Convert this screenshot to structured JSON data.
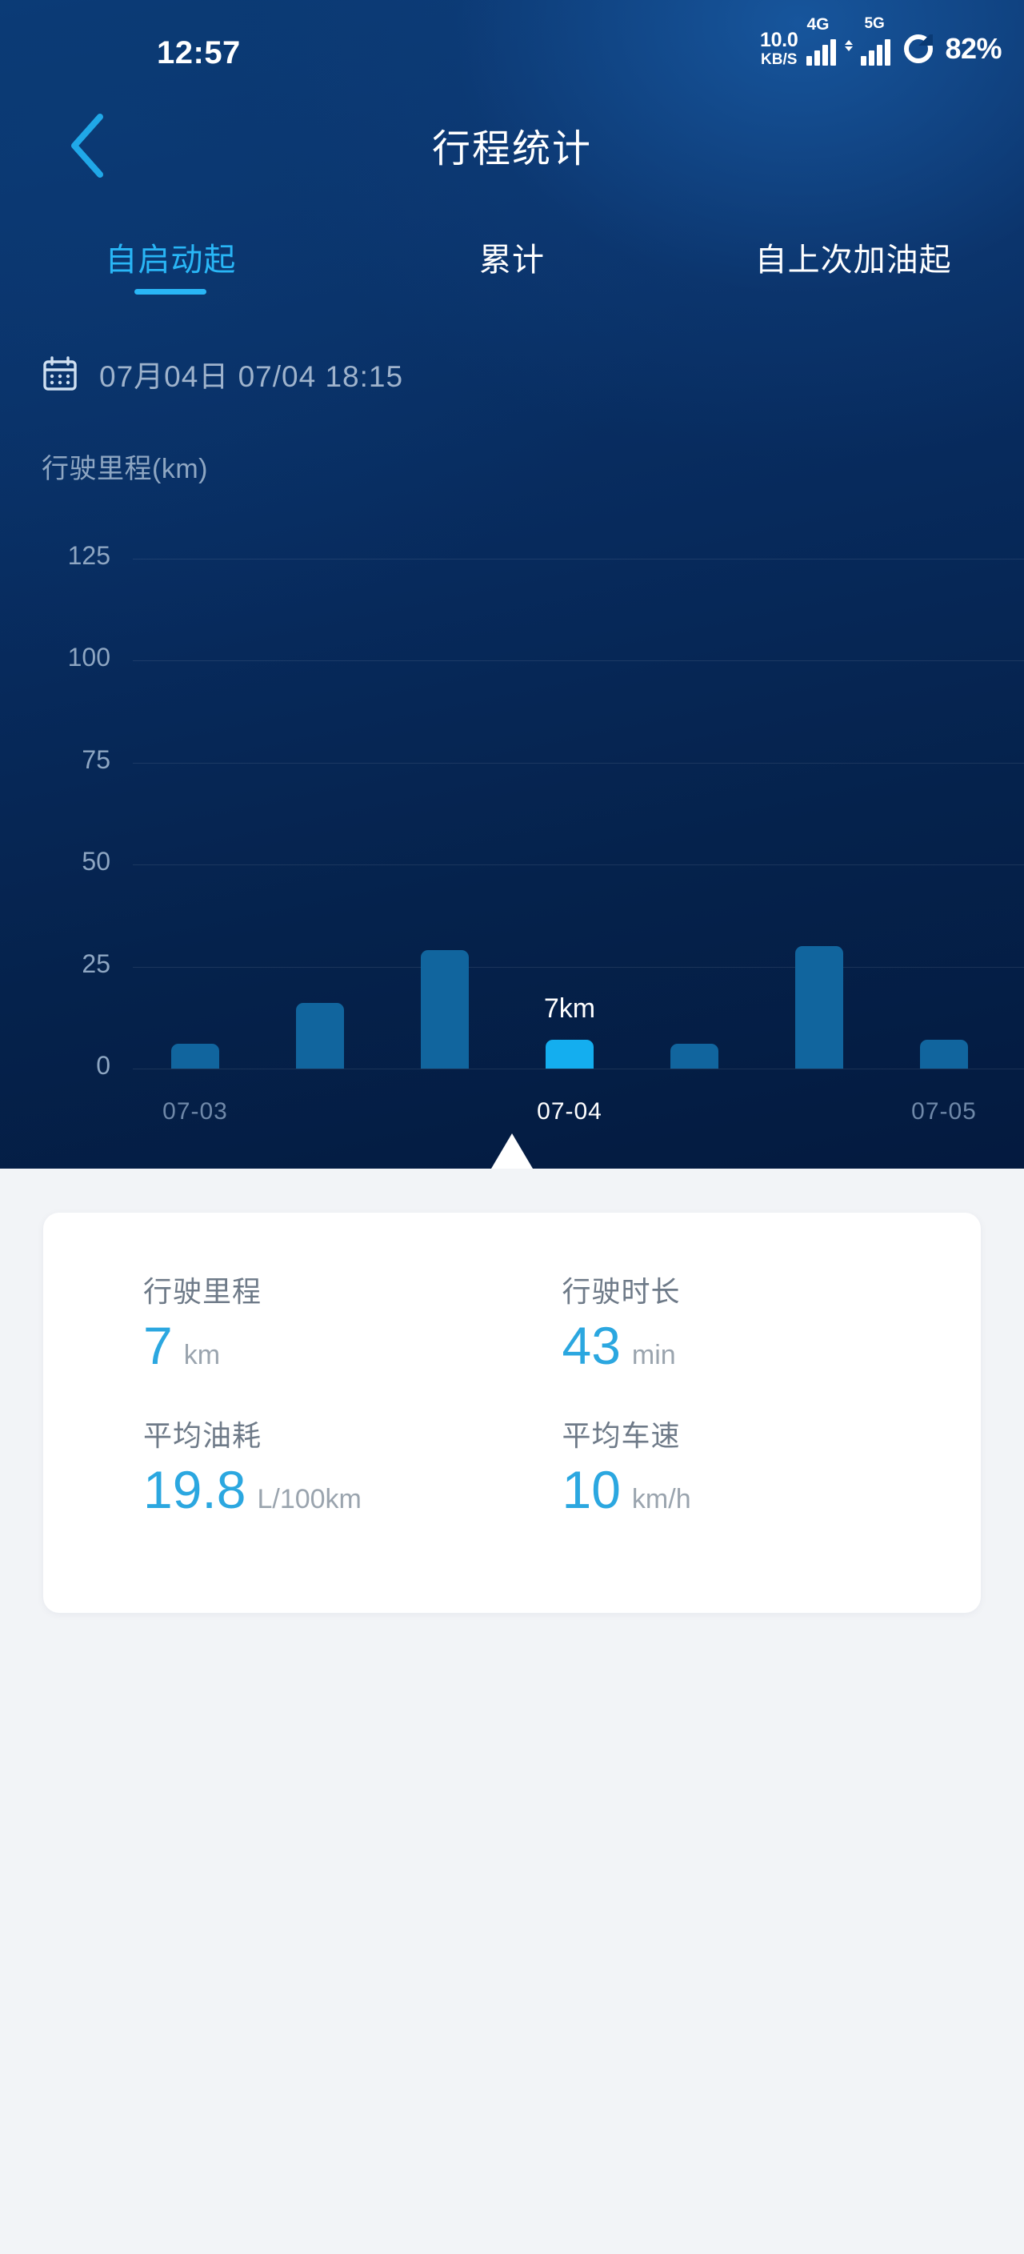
{
  "status_bar": {
    "clock": "12:57",
    "net_speed_value": "10.0",
    "net_speed_unit": "KB/S",
    "sim1_network": "4G",
    "sim2_network": "5G",
    "battery_percent": "82%"
  },
  "nav": {
    "title": "行程统计",
    "back_icon": "chevron-left-icon"
  },
  "tabs": [
    {
      "label": "自启动起",
      "active": true
    },
    {
      "label": "累计",
      "active": false
    },
    {
      "label": "自上次加油起",
      "active": false
    }
  ],
  "date_row": {
    "icon": "calendar-icon",
    "text": "07月04日  07/04 18:15"
  },
  "chart_data": {
    "type": "bar",
    "title": "行驶里程(km)",
    "xlabel": "",
    "ylabel": "行驶里程(km)",
    "ylim": [
      0,
      125
    ],
    "yticks": [
      0,
      25,
      50,
      75,
      100,
      125
    ],
    "ytick_labels": [
      "0",
      "25",
      "50",
      "75",
      "100",
      "125"
    ],
    "grid": true,
    "categories": [
      "",
      "",
      "",
      "07-04",
      "",
      "",
      ""
    ],
    "x_axis_labels": [
      {
        "label": "07-03",
        "index": 0,
        "active": false
      },
      {
        "label": "07-04",
        "index": 3,
        "active": true
      },
      {
        "label": "07-05",
        "index": 6,
        "active": false
      }
    ],
    "values": [
      6,
      16,
      29,
      7,
      6,
      30,
      7
    ],
    "highlight_index": 3,
    "highlight_label": "7km",
    "bar_color": "#11659e",
    "highlight_color": "#14aeef",
    "legend": []
  },
  "stats": [
    {
      "label": "行驶里程",
      "value": "7",
      "unit": "km"
    },
    {
      "label": "行驶时长",
      "value": "43",
      "unit": "min"
    },
    {
      "label": "平均油耗",
      "value": "19.8",
      "unit": "L/100km"
    },
    {
      "label": "平均车速",
      "value": "10",
      "unit": "km/h"
    }
  ],
  "colors": {
    "accent": "#29b6f6",
    "value_blue": "#2ba7e0",
    "panel_dark": "#05224c",
    "page_bg": "#f2f4f7"
  }
}
